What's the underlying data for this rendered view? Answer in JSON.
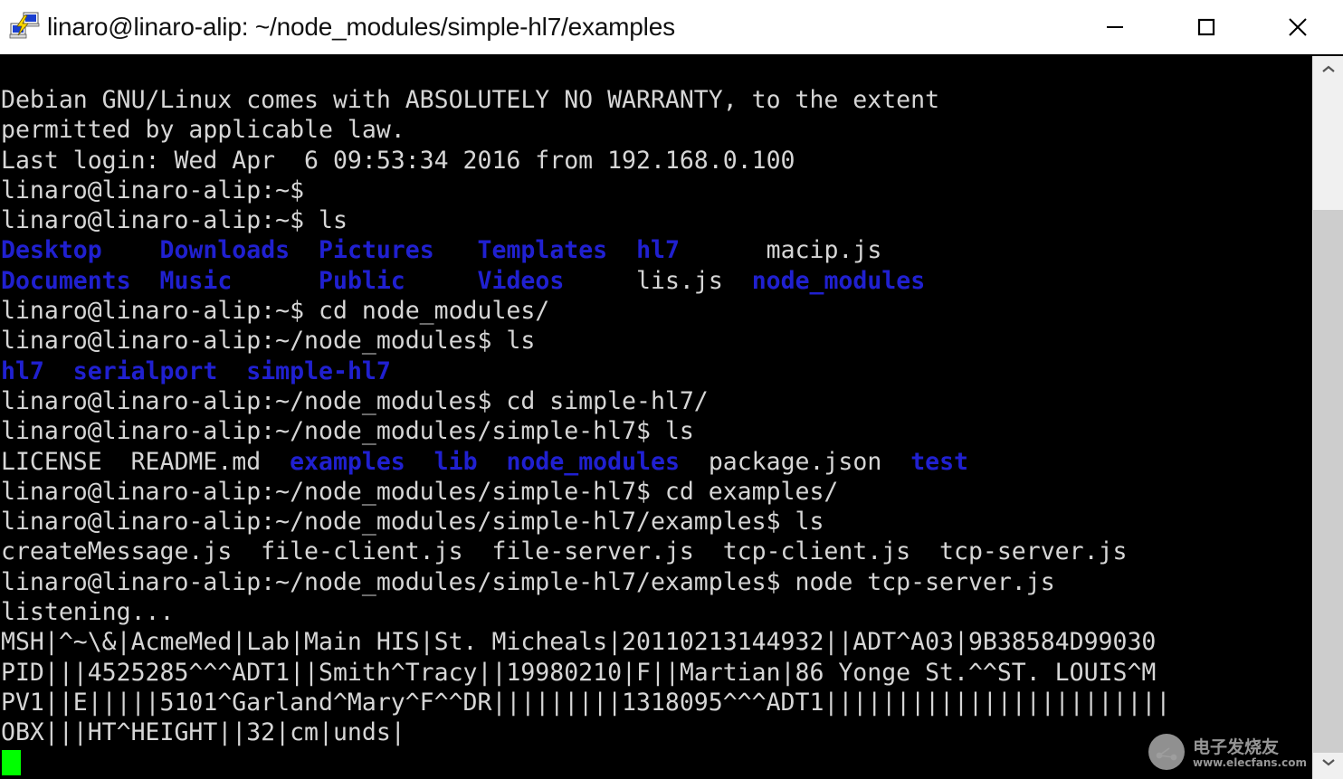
{
  "window": {
    "title": "linaro@linaro-alip: ~/node_modules/simple-hl7/examples",
    "icon": "putty-terminal-icon",
    "controls": {
      "minimize": "minimize-icon",
      "maximize": "maximize-icon",
      "close": "close-icon"
    }
  },
  "colors": {
    "terminal_background": "#000000",
    "terminal_foreground": "#d6d6d6",
    "directory": "#2020d0",
    "cursor": "#00ff00",
    "titlebar_background": "#ffffff",
    "scrollbar_track": "#f0f0f0",
    "scrollbar_thumb": "#cdcdcd"
  },
  "terminal": {
    "lines": [
      [
        {
          "t": "Debian GNU/Linux comes with ABSOLUTELY NO WARRANTY, to the extent",
          "c": "plain"
        }
      ],
      [
        {
          "t": "permitted by applicable law.",
          "c": "plain"
        }
      ],
      [
        {
          "t": "Last login: Wed Apr  6 09:53:34 2016 from 192.168.0.100",
          "c": "plain"
        }
      ],
      [
        {
          "t": "linaro@linaro-alip:~$ ",
          "c": "plain"
        }
      ],
      [
        {
          "t": "linaro@linaro-alip:~$ ls",
          "c": "plain"
        }
      ],
      [
        {
          "t": "Desktop",
          "c": "dir"
        },
        {
          "t": "    ",
          "c": "plain"
        },
        {
          "t": "Downloads",
          "c": "dir"
        },
        {
          "t": "  ",
          "c": "plain"
        },
        {
          "t": "Pictures",
          "c": "dir"
        },
        {
          "t": "   ",
          "c": "plain"
        },
        {
          "t": "Templates",
          "c": "dir"
        },
        {
          "t": "  ",
          "c": "plain"
        },
        {
          "t": "hl7",
          "c": "dir"
        },
        {
          "t": "      macip.js",
          "c": "plain"
        }
      ],
      [
        {
          "t": "Documents",
          "c": "dir"
        },
        {
          "t": "  ",
          "c": "plain"
        },
        {
          "t": "Music",
          "c": "dir"
        },
        {
          "t": "      ",
          "c": "plain"
        },
        {
          "t": "Public",
          "c": "dir"
        },
        {
          "t": "     ",
          "c": "plain"
        },
        {
          "t": "Videos",
          "c": "dir"
        },
        {
          "t": "     lis.js  ",
          "c": "plain"
        },
        {
          "t": "node_modules",
          "c": "dir"
        }
      ],
      [
        {
          "t": "linaro@linaro-alip:~$ cd node_modules/",
          "c": "plain"
        }
      ],
      [
        {
          "t": "linaro@linaro-alip:~/node_modules$ ls",
          "c": "plain"
        }
      ],
      [
        {
          "t": "hl7",
          "c": "dir"
        },
        {
          "t": "  ",
          "c": "plain"
        },
        {
          "t": "serialport",
          "c": "dir"
        },
        {
          "t": "  ",
          "c": "plain"
        },
        {
          "t": "simple-hl7",
          "c": "dir"
        }
      ],
      [
        {
          "t": "linaro@linaro-alip:~/node_modules$ cd simple-hl7/",
          "c": "plain"
        }
      ],
      [
        {
          "t": "linaro@linaro-alip:~/node_modules/simple-hl7$ ls",
          "c": "plain"
        }
      ],
      [
        {
          "t": "LICENSE  README.md  ",
          "c": "plain"
        },
        {
          "t": "examples",
          "c": "dir"
        },
        {
          "t": "  ",
          "c": "plain"
        },
        {
          "t": "lib",
          "c": "dir"
        },
        {
          "t": "  ",
          "c": "plain"
        },
        {
          "t": "node_modules",
          "c": "dir"
        },
        {
          "t": "  package.json  ",
          "c": "plain"
        },
        {
          "t": "test",
          "c": "dir"
        }
      ],
      [
        {
          "t": "linaro@linaro-alip:~/node_modules/simple-hl7$ cd examples/",
          "c": "plain"
        }
      ],
      [
        {
          "t": "linaro@linaro-alip:~/node_modules/simple-hl7/examples$ ls",
          "c": "plain"
        }
      ],
      [
        {
          "t": "createMessage.js  file-client.js  file-server.js  tcp-client.js  tcp-server.js",
          "c": "plain"
        }
      ],
      [
        {
          "t": "linaro@linaro-alip:~/node_modules/simple-hl7/examples$ node tcp-server.js",
          "c": "plain"
        }
      ],
      [
        {
          "t": "listening...",
          "c": "plain"
        }
      ],
      [
        {
          "t": "MSH|^~\\&|AcmeMed|Lab|Main HIS|St. Micheals|20110213144932||ADT^A03|9B38584D99030",
          "c": "plain"
        }
      ],
      [
        {
          "t": "PID|||4525285^^^ADT1||Smith^Tracy||19980210|F||Martian|86 Yonge St.^^ST. LOUIS^M",
          "c": "plain"
        }
      ],
      [
        {
          "t": "PV1||E|||||5101^Garland^Mary^F^^DR|||||||||1318095^^^ADT1||||||||||||||||||||||||",
          "c": "plain"
        }
      ],
      [
        {
          "t": "OBX|||HT^HEIGHT||32|cm|unds|",
          "c": "plain"
        }
      ]
    ]
  },
  "scrollbar": {
    "up_arrow": "chevron-up-icon",
    "down_arrow": "chevron-down-icon"
  },
  "watermark": {
    "cn_text": "电子发烧友",
    "url": "www.elecfans.com"
  }
}
